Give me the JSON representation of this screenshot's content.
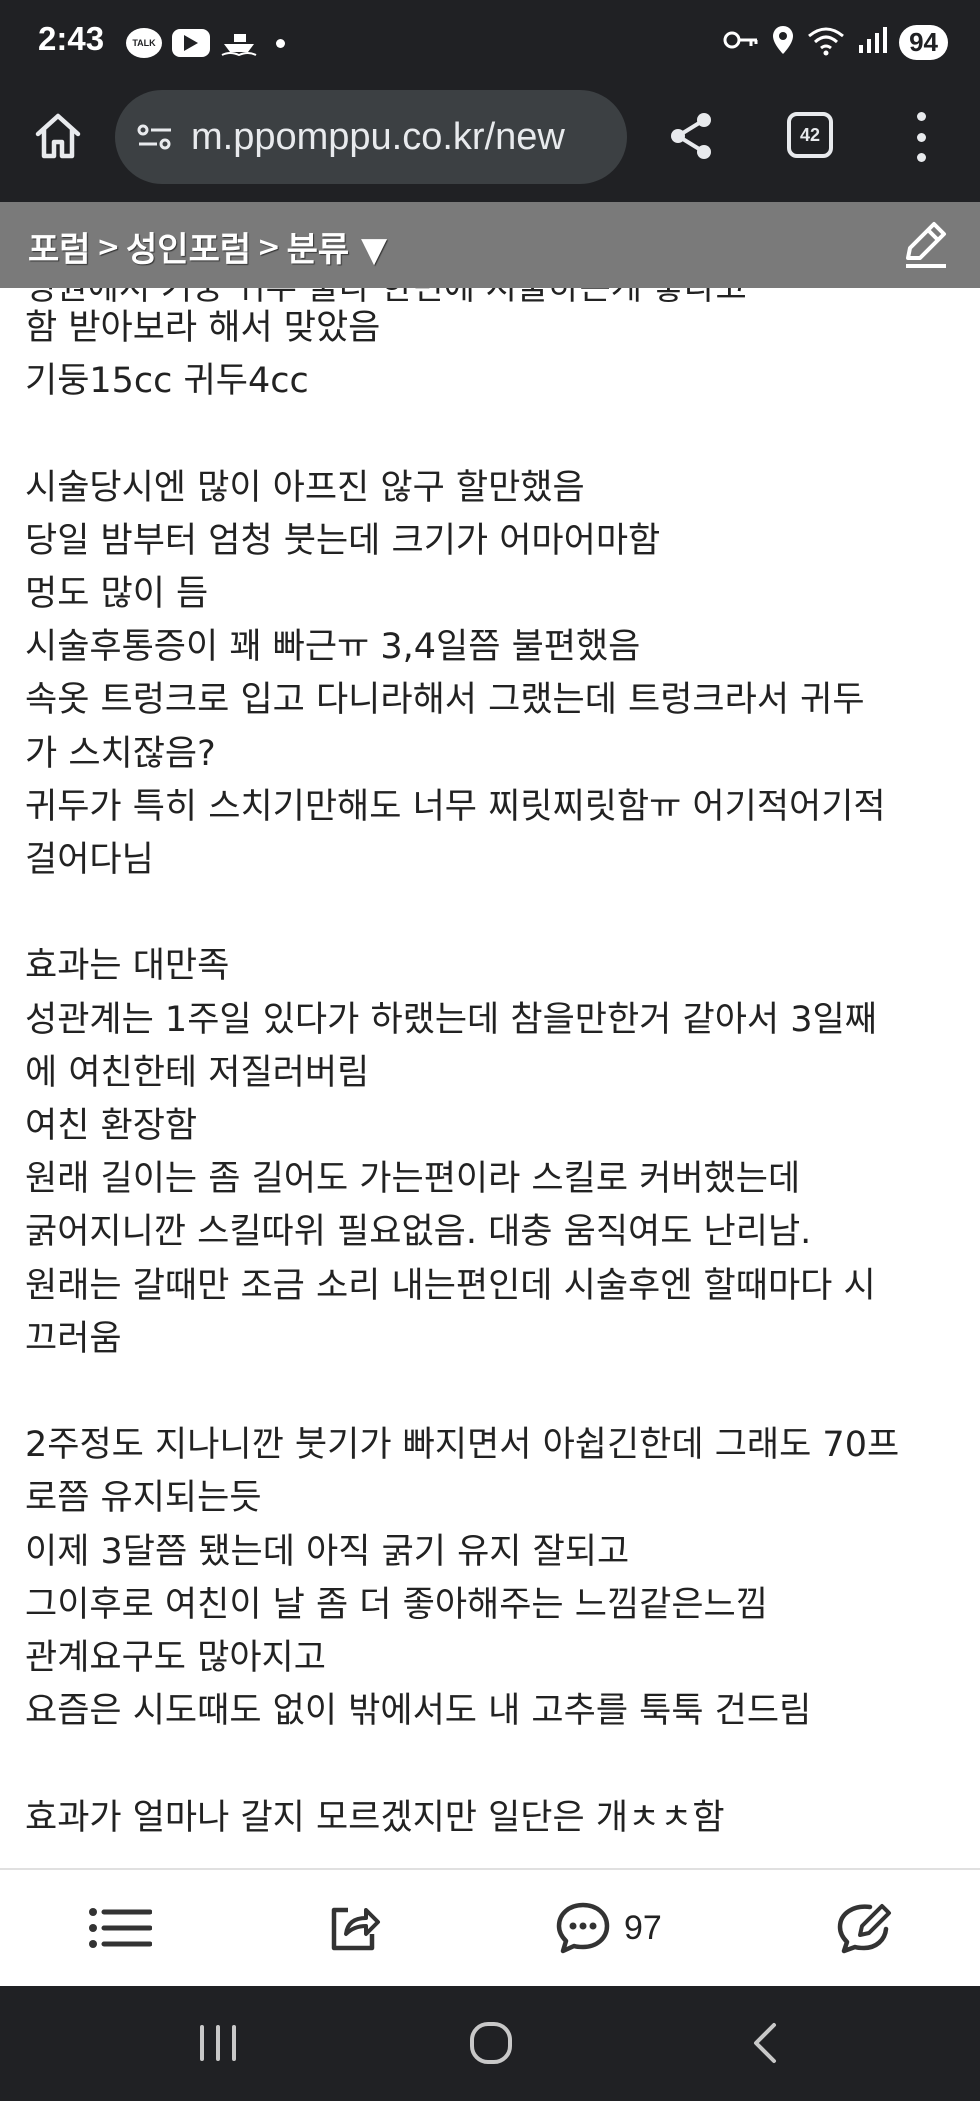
{
  "status_bar": {
    "time": "2:43",
    "battery": "94",
    "left_icons": [
      "talk-icon",
      "youtube-icon",
      "boat-icon",
      "dot-icon"
    ],
    "talk_label": "TALK",
    "right_icons": [
      "key-icon",
      "location-icon",
      "wifi-icon",
      "signal-icon"
    ]
  },
  "browser": {
    "url": "m.ppomppu.co.kr/new",
    "tab_count": "42"
  },
  "forum_nav": {
    "crumb1": "포럼",
    "sep": ">",
    "crumb2": "성인포럼",
    "crumb3": "분류",
    "dropdown_arrow": "▼"
  },
  "post": {
    "partial_line": "병원에서 기둥 귀두 둘다 한번에 시술하는게 좋다고",
    "lines": [
      "함 받아보라 해서 맞았음",
      "기둥15cc 귀두4cc",
      "",
      "시술당시엔 많이 아프진 않구 할만했음",
      "당일 밤부터 엄청 붓는데 크기가 어마어마함",
      "멍도 많이 듬",
      "시술후통증이 꽤 빠근ㅠ 3,4일쯤 불편했음",
      "속옷 트렁크로 입고 다니라해서 그랬는데 트렁크라서 귀두",
      "가 스치잖음?",
      "귀두가 특히 스치기만해도 너무 찌릿찌릿함ㅠ 어기적어기적",
      "걸어다님",
      "",
      "효과는 대만족",
      "성관계는 1주일 있다가 하랬는데 참을만한거 같아서 3일째",
      "에 여친한테 저질러버림",
      "여친 환장함",
      "원래 길이는 좀 길어도 가는편이라 스킬로 커버했는데",
      "굵어지니깐 스킬따위 필요없음. 대충 움직여도 난리남.",
      "원래는 갈때만 조금 소리 내는편인데 시술후엔 할때마다 시",
      "끄러움",
      "",
      "2주정도 지나니깐 붓기가 빠지면서 아쉽긴한데 그래도 70프",
      "로쯤 유지되는듯",
      "이제 3달쯤 됐는데 아직 굵기 유지 잘되고",
      "그이후로 여친이 날 좀 더 좋아해주는 느낌같은느낌",
      "관계요구도 많아지고",
      "요즘은 시도때도 없이 밖에서도 내 고추를 툭툭 건드림",
      "",
      "효과가 얼마나 갈지 모르겠지만 일단은 개ㅊㅊ함"
    ]
  },
  "toolbar": {
    "comment_count": "97"
  },
  "colors": {
    "status_bg": "#202124",
    "forum_bar_bg": "#7a7a7a",
    "text": "#222222"
  }
}
